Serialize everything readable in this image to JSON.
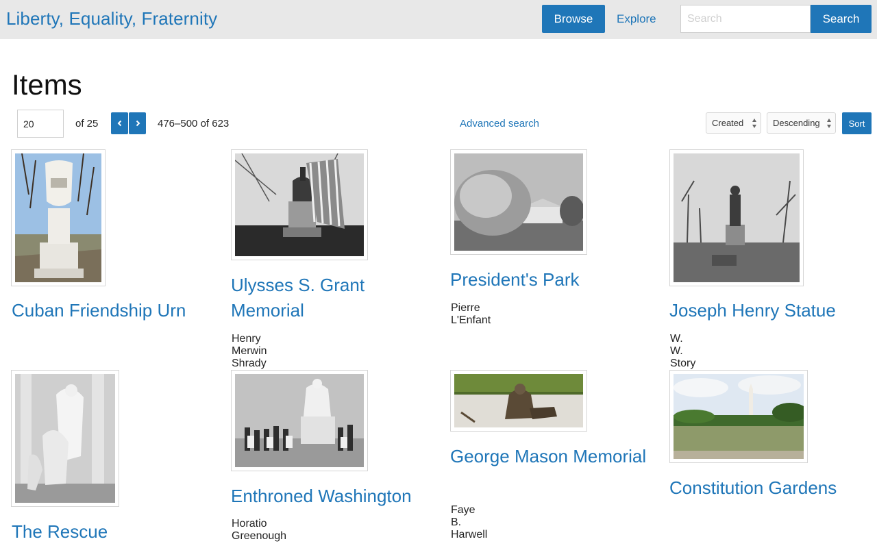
{
  "site": {
    "title": "Liberty, Equality, Fraternity"
  },
  "nav": {
    "browse_label": "Browse",
    "explore_label": "Explore"
  },
  "search": {
    "placeholder": "Search",
    "button_label": "Search"
  },
  "page": {
    "title": "Items"
  },
  "pagination": {
    "current_page": "20",
    "of_total": "of 25",
    "range_text": "476–500 of 623"
  },
  "advanced_search_label": "Advanced search",
  "sort": {
    "field_selected": "Created",
    "order_selected": "Descending",
    "button_label": "Sort"
  },
  "items": [
    {
      "title": "Cuban Friendship Urn",
      "creator": ""
    },
    {
      "title": "Ulysses S. Grant Memorial",
      "creator": "Henry Merwin Shrady"
    },
    {
      "title": "President's Park",
      "creator": "Pierre L'Enfant"
    },
    {
      "title": "Joseph Henry Statue",
      "creator": "W. W. Story"
    },
    {
      "title": "The Rescue",
      "creator": ""
    },
    {
      "title": "Enthroned Washington",
      "creator": "Horatio Greenough"
    },
    {
      "title": "George Mason Memorial",
      "creator": "Faye B. Harwell"
    },
    {
      "title": "Constitution Gardens",
      "creator": ""
    }
  ],
  "colors": {
    "accent": "#1f76b8",
    "topbar_bg": "#e8e8e8"
  }
}
